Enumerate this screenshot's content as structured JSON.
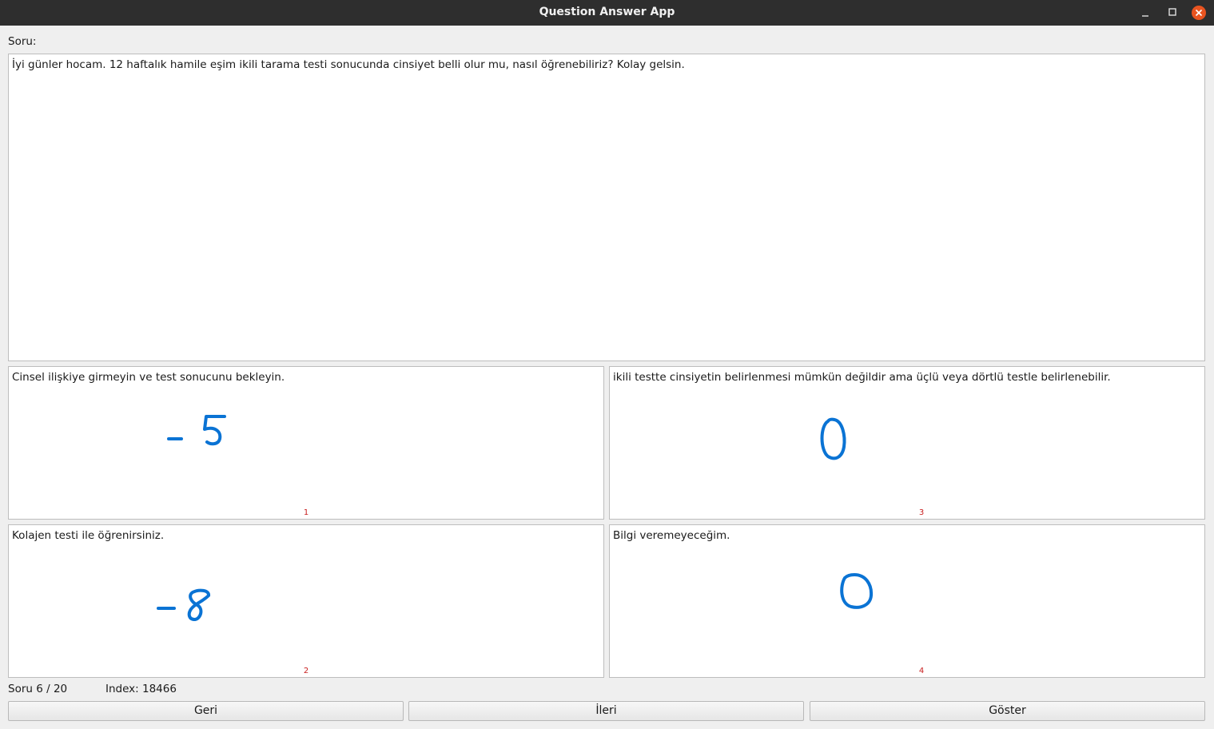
{
  "window": {
    "title": "Question Answer App"
  },
  "question": {
    "label": "Soru:",
    "text": "İyi günler hocam. 12 haftalık hamile eşim ikili tarama testi sonucunda cinsiyet belli olur mu, nasıl öğrenebiliriz? Kolay gelsin."
  },
  "answers": [
    {
      "number": "1",
      "text": "Cinsel ilişkiye girmeyin ve test sonucunu bekleyin.",
      "handwritten_score": "-5"
    },
    {
      "number": "2",
      "text": "Kolajen testi ile öğrenirsiniz.",
      "handwritten_score": "-8"
    },
    {
      "number": "3",
      "text": "ikili testte cinsiyetin belirlenmesi mümkün değildir ama üçlü veya dörtlü testle belirlenebilir.",
      "handwritten_score": "0"
    },
    {
      "number": "4",
      "text": "Bilgi veremeyeceğim.",
      "handwritten_score": "0"
    }
  ],
  "status": {
    "counter": "Soru 6 / 20",
    "index": "Index: 18466"
  },
  "buttons": {
    "back": "Geri",
    "next": "İleri",
    "show": "Göster"
  },
  "colors": {
    "titlebar": "#2e2e2e",
    "close": "#e95420",
    "ink": "#0a73d4",
    "number": "#c81e1e"
  }
}
